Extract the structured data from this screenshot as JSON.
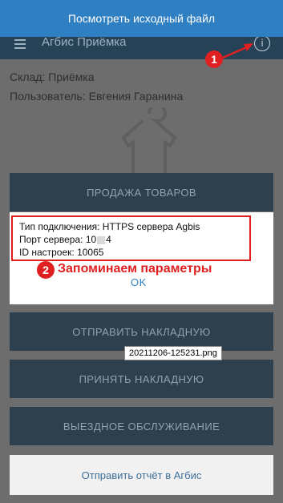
{
  "viewer": {
    "title": "Посмотреть исходный файл"
  },
  "app": {
    "title": "Агбис Приёмка"
  },
  "info": {
    "warehouse": "Склад: Приёмка",
    "user": "Пользователь: Евгения Гаранина"
  },
  "menu": {
    "sell": "ПРОДАЖА ТОВАРОВ",
    "send_invoice": "ОТПРАВИТЬ НАКЛАДНУЮ",
    "accept_invoice": "ПРИНЯТЬ НАКЛАДНУЮ",
    "field_service": "ВЫЕЗДНОЕ ОБСЛУЖИВАНИЕ"
  },
  "dialog": {
    "connection_type": "Тип подключения: HTTPS сервера Agbis",
    "port_prefix": "Порт сервера: 10",
    "port_suffix": "4",
    "settings_id": "ID настроек: 10065",
    "ok": "OK"
  },
  "annotations": {
    "badge_1": "1",
    "badge_2": "2",
    "remember": "Запоминаем параметры",
    "file_tooltip": "20211206-125231.png"
  },
  "bottom": {
    "send_report": "Отправить отчёт в Агбис"
  },
  "colors": {
    "viewer_bar": "#2f7fc3",
    "annotation_red": "#e02020",
    "button_dark": "#2e3f4e"
  }
}
